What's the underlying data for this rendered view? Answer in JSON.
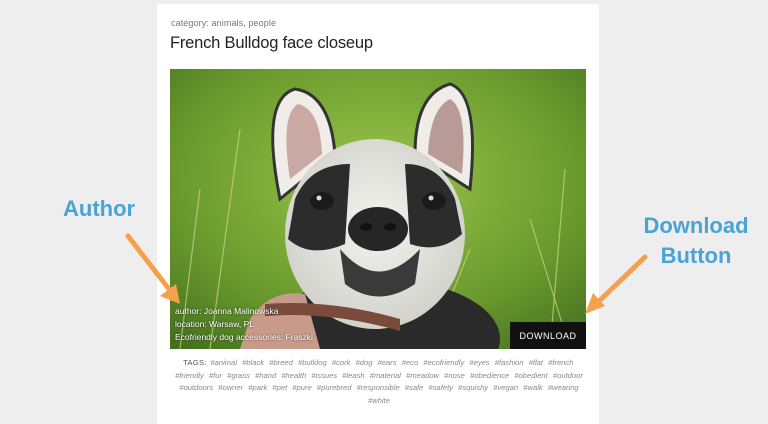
{
  "post": {
    "category_prefix": "category:",
    "categories": [
      "animals",
      "people"
    ],
    "title": "French Bulldog face closeup",
    "caption_author": "author: Joanna Malinowska",
    "caption_location": "location: Warsaw, PL",
    "caption_credit": "Ecofriendly dog accessories: Fraszki",
    "download_label": "DOWNLOAD"
  },
  "tags_label": "TAGS:",
  "tags": [
    "#animal",
    "#black",
    "#breed",
    "#bulldog",
    "#cork",
    "#dog",
    "#ears",
    "#eco",
    "#ecofriendly",
    "#eyes",
    "#fashion",
    "#flat",
    "#french",
    "#friendly",
    "#fur",
    "#grass",
    "#hand",
    "#health",
    "#issues",
    "#leash",
    "#material",
    "#meadow",
    "#nose",
    "#obedience",
    "#obedient",
    "#outdoor",
    "#outdoors",
    "#owner",
    "#park",
    "#pet",
    "#pure",
    "#purebred",
    "#responsible",
    "#safe",
    "#safety",
    "#squishy",
    "#vegan",
    "#walk",
    "#wearing",
    "#white"
  ],
  "annotations": {
    "author_label": "Author",
    "download_line1": "Download",
    "download_line2": "Button",
    "arrow_color": "#f5a04a",
    "label_color": "#4aa3d6"
  }
}
